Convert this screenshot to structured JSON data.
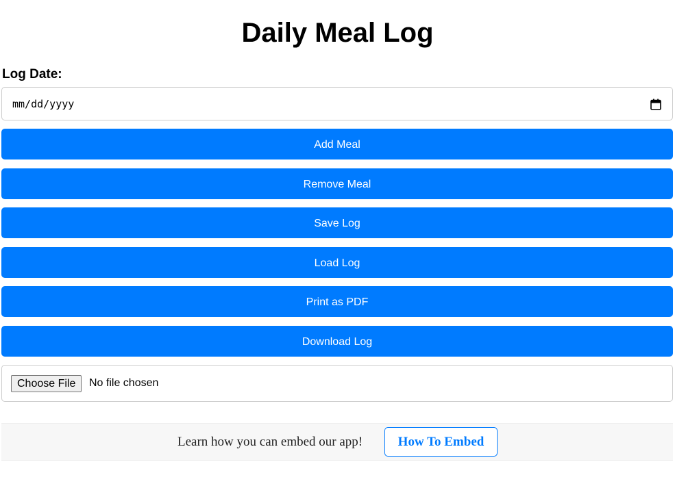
{
  "header": {
    "title": "Daily Meal Log"
  },
  "date_field": {
    "label": "Log Date:",
    "placeholder": "mm/dd/yyyy",
    "icon": "calendar-icon"
  },
  "buttons": [
    {
      "label": "Add Meal"
    },
    {
      "label": "Remove Meal"
    },
    {
      "label": "Save Log"
    },
    {
      "label": "Load Log"
    },
    {
      "label": "Print as PDF"
    },
    {
      "label": "Download Log"
    }
  ],
  "file_input": {
    "button_label": "Choose File",
    "status": "No file chosen"
  },
  "embed": {
    "text": "Learn how you can embed our app!",
    "button_label": "How To Embed"
  },
  "colors": {
    "accent": "#007bff",
    "button_text": "#ffffff",
    "embed_bar_bg": "#f7f7f7"
  }
}
